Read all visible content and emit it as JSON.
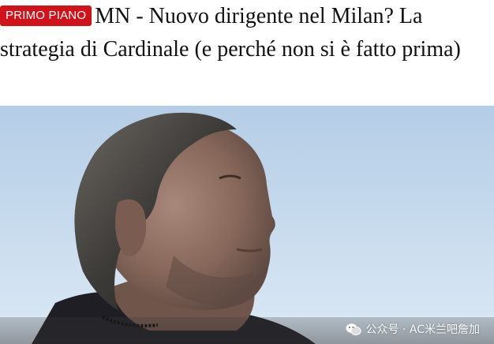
{
  "article": {
    "badge": "PRIMO PIANO",
    "title": "MN - Nuovo dirigente nel Milan? La strategia di Cardinale (e perché non si è fatto prima)"
  },
  "photo": {
    "subject": "portrait-photo",
    "colors": {
      "sky_top": "#b7cfe6",
      "sky_bottom": "#dbe8f4",
      "skin": "#8b6b5a",
      "hair": "#3b3a38",
      "jacket": "#1e1e24"
    }
  },
  "watermark": {
    "icon": "wechat-icon",
    "text": "公众号 · AC米兰吧詹加"
  },
  "colors": {
    "badge_bg": "#d0121a",
    "badge_text": "#ffffff",
    "headline_text": "#111111"
  }
}
